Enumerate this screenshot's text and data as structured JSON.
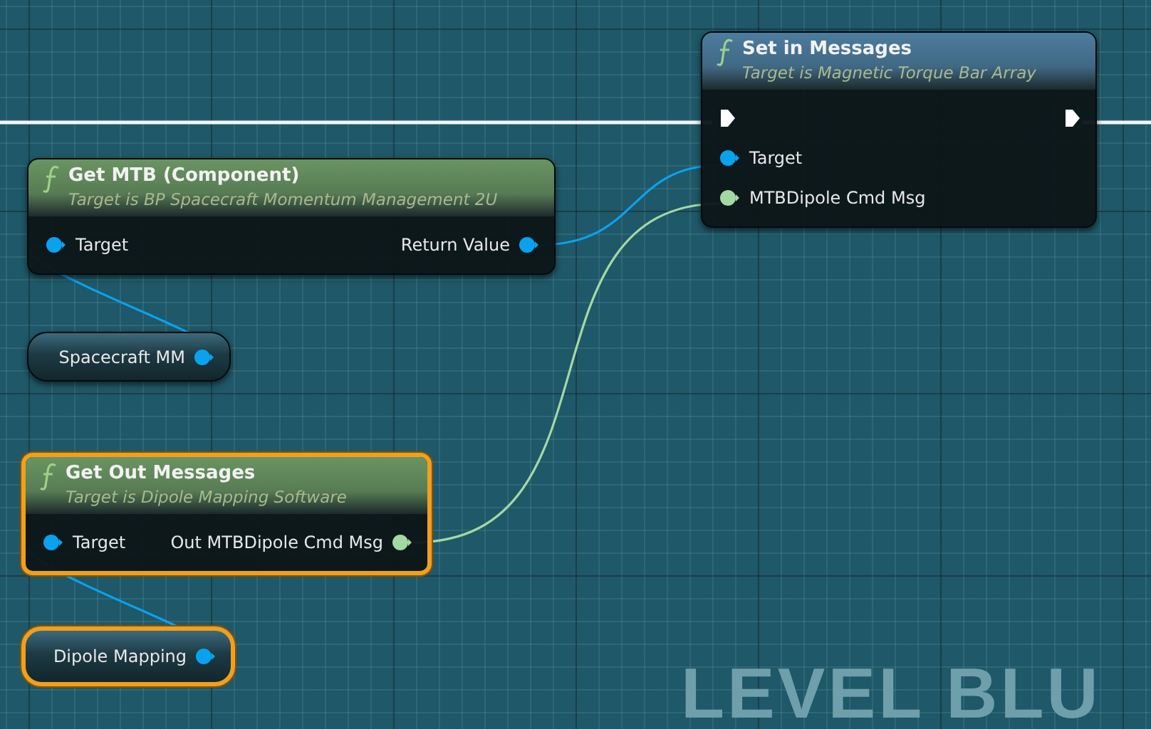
{
  "graph": {
    "watermark": "LEVEL BLU"
  },
  "nodes": [
    {
      "kind": "function",
      "title": "Set in Messages",
      "subtitle": "Target is Magnetic Torque Bar Array",
      "color": "#4d7c9e",
      "selected": false,
      "rows": [
        {
          "left": {
            "kind": "exec"
          },
          "right": {
            "kind": "exec"
          }
        },
        {
          "left": {
            "kind": "object",
            "label": "Target"
          }
        },
        {
          "left": {
            "kind": "struct",
            "label": "MTBDipole Cmd Msg"
          }
        }
      ]
    },
    {
      "kind": "function",
      "title": "Get MTB (Component)",
      "subtitle": "Target is BP Spacecraft Momentum Management 2U",
      "color": "#6a9462",
      "selected": false,
      "rows": [
        {
          "left": {
            "kind": "object",
            "label": "Target"
          },
          "right": {
            "kind": "object",
            "label": "Return Value"
          }
        }
      ]
    },
    {
      "kind": "variable",
      "title": "Spacecraft MM",
      "selected": false,
      "pin": {
        "kind": "object"
      }
    },
    {
      "kind": "function",
      "title": "Get Out Messages",
      "subtitle": "Target is Dipole Mapping Software",
      "color": "#6a9462",
      "selected": true,
      "rows": [
        {
          "left": {
            "kind": "object",
            "label": "Target"
          },
          "right": {
            "kind": "struct",
            "label": "Out MTBDipole Cmd Msg"
          }
        }
      ]
    },
    {
      "kind": "variable",
      "title": "Dipole Mapping",
      "selected": true,
      "pin": {
        "kind": "object"
      }
    }
  ]
}
